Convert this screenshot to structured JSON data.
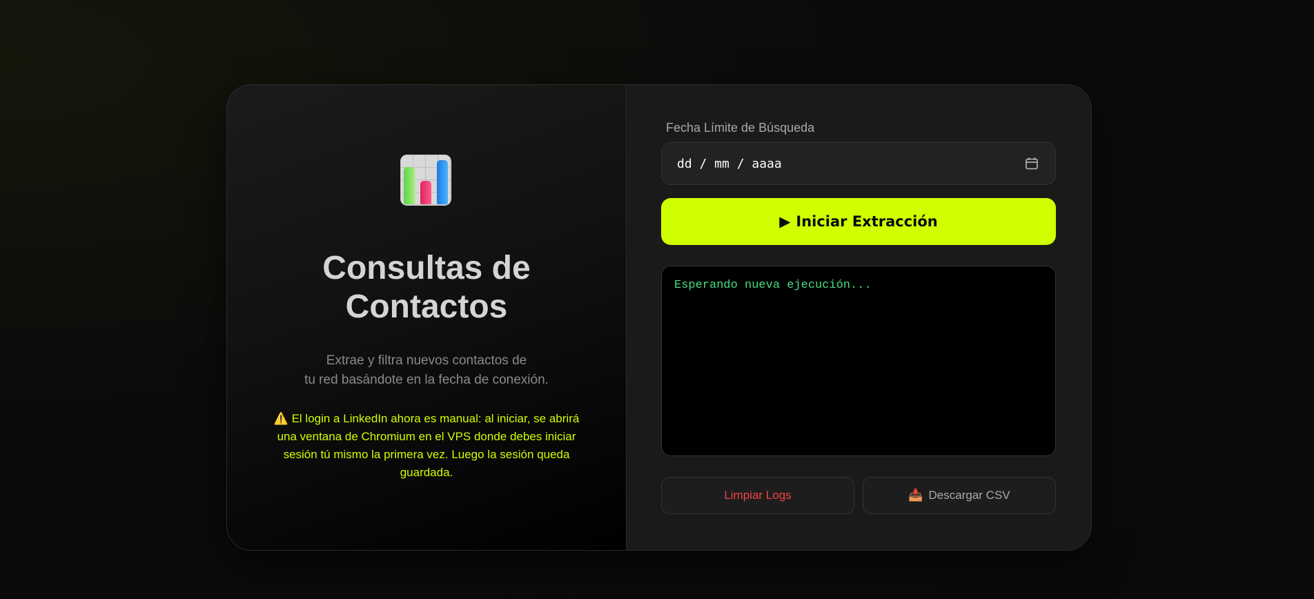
{
  "left": {
    "logo_icon": "bar-chart-icon",
    "title_line1": "Consultas de",
    "title_line2": "Contactos",
    "subtitle_line1": "Extrae y filtra nuevos contactos de",
    "subtitle_line2": "tu red basándote en la fecha de conexión.",
    "warning_icon": "⚠️",
    "warning_text": "El login a LinkedIn ahora es manual: al iniciar, se abrirá una ventana de Chromium en el VPS donde debes iniciar sesión tú mismo la primera vez. Luego la sesión queda guardada."
  },
  "form": {
    "date_label": "Fecha Límite de Búsqueda",
    "date_placeholder": "dd / mm / aaaa",
    "start_icon": "▶",
    "start_label": "Iniciar Extracción"
  },
  "console": {
    "log_line": "Esperando nueva ejecución..."
  },
  "actions": {
    "clear_label": "Limpiar Logs",
    "download_icon": "📥",
    "download_label": "Descargar CSV"
  },
  "colors": {
    "accent": "#d0ff00",
    "danger": "#ef4444",
    "console_text": "#4ade80"
  }
}
